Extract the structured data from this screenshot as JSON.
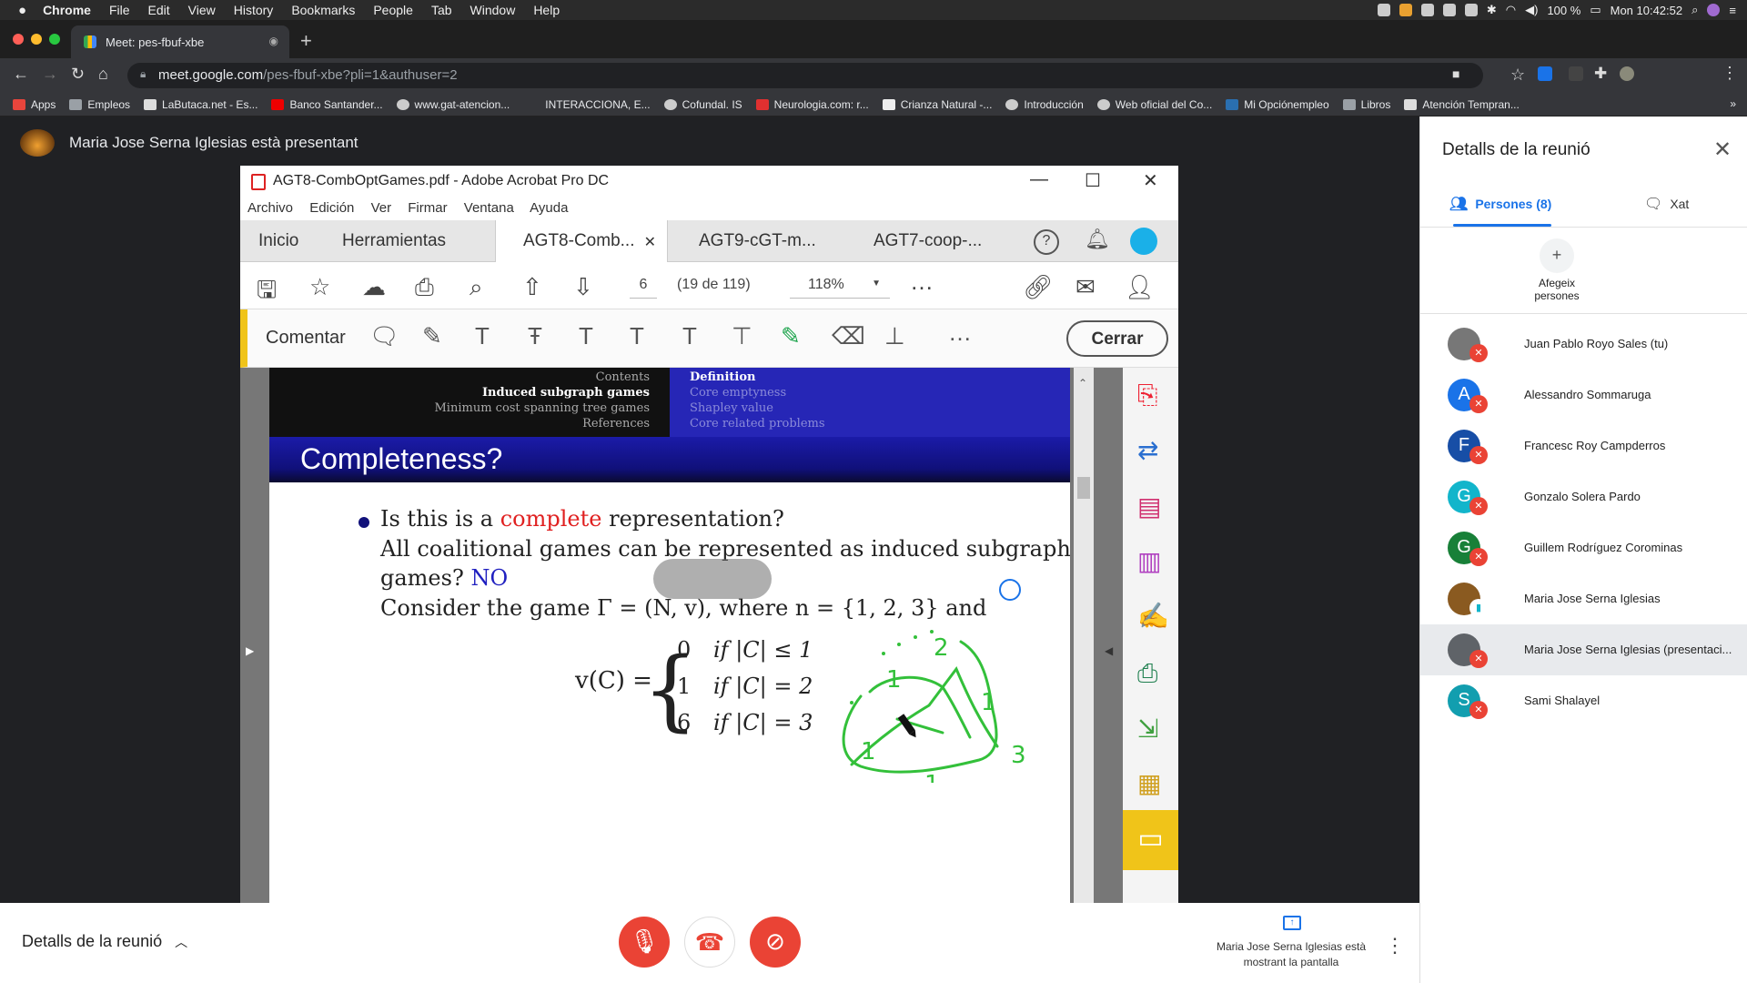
{
  "macos_menubar": {
    "app": "Chrome",
    "items": [
      "File",
      "Edit",
      "View",
      "History",
      "Bookmarks",
      "People",
      "Tab",
      "Window",
      "Help"
    ],
    "battery": "100 %",
    "clock": "Mon 10:42:52"
  },
  "browser": {
    "tab_title": "Meet: pes-fbuf-xbe",
    "url_host": "meet.google.com",
    "url_path": "/pes-fbuf-xbe?pli=1&authuser=2",
    "bookmarks": [
      "Apps",
      "Empleos",
      "LaButaca.net - Es...",
      "Banco Santander...",
      "www.gat-atencion...",
      "INTERACCIONA, E...",
      "Cofundal. IS",
      "Neurologia.com: r...",
      "Crianza Natural -...",
      "Introducción",
      "Web oficial del Co...",
      "Mi Opciónempleo",
      "Libros",
      "Atención Tempran..."
    ],
    "bookmarks_more": "»"
  },
  "meet": {
    "presenter_banner": "Maria Jose Serna Iglesias està presentant",
    "details_label": "Detalls de la reunió",
    "presenting_info": "Maria Jose Serna Iglesias està mostrant la pantalla",
    "panel": {
      "title": "Detalls de la reunió",
      "tab_people": "Persones (8)",
      "tab_chat": "Xat",
      "add_people": "Afegeix persones",
      "participants": [
        {
          "name": "Juan Pablo Royo Sales (tu)",
          "initial": "",
          "color": "#777777",
          "photo": true
        },
        {
          "name": "Alessandro Sommaruga",
          "initial": "A",
          "color": "#1a73e8"
        },
        {
          "name": "Francesc Roy Campderros",
          "initial": "F",
          "color": "#174ea6"
        },
        {
          "name": "Gonzalo Solera Pardo",
          "initial": "G",
          "color": "#12b5cb"
        },
        {
          "name": "Guillem Rodríguez Corominas",
          "initial": "G",
          "color": "#188038"
        },
        {
          "name": "Maria Jose Serna Iglesias",
          "initial": "",
          "color": "#8a5a20",
          "photo": true
        },
        {
          "name": "Maria Jose Serna Iglesias (presentaci...",
          "initial": "",
          "color": "#5f6368",
          "photo": true
        },
        {
          "name": "Sami Shalayel",
          "initial": "S",
          "color": "#129eaf"
        }
      ]
    }
  },
  "acrobat": {
    "window_title": "AGT8-CombOptGames.pdf - Adobe Acrobat Pro DC",
    "menu": [
      "Archivo",
      "Edición",
      "Ver",
      "Firmar",
      "Ventana",
      "Ayuda"
    ],
    "tabs": [
      "Inicio",
      "Herramientas",
      "AGT8-Comb...",
      "AGT9-cGT-m...",
      "AGT7-coop-..."
    ],
    "page_number": "6",
    "page_count": "(19 de 119)",
    "zoom": "118%",
    "comment_label": "Comentar",
    "close_label": "Cerrar"
  },
  "slide": {
    "nav_left": [
      "Contents",
      "Induced subgraph games",
      "Minimum cost spanning tree games",
      "References"
    ],
    "nav_right": [
      "Definition",
      "Core emptyness",
      "Shapley value",
      "Core related problems"
    ],
    "frame_title": "Completeness?",
    "line1_a": "Is this is a ",
    "line1_b": "complete",
    "line1_c": " representation?",
    "line2": "All coalitional games can be represented as induced subgraph",
    "line3_a": "games? ",
    "line3_b": "NO",
    "line4": "Consider the game Γ = (N, v), where n = {1, 2, 3} and",
    "vc": "v(C) =",
    "cases": [
      {
        "val": "0",
        "cond": "if |C| ≤ 1"
      },
      {
        "val": "1",
        "cond": "if |C| = 2"
      },
      {
        "val": "6",
        "cond": "if |C| = 3"
      }
    ],
    "annotations": [
      "2",
      "1",
      "1",
      "3",
      "1",
      "1"
    ]
  }
}
